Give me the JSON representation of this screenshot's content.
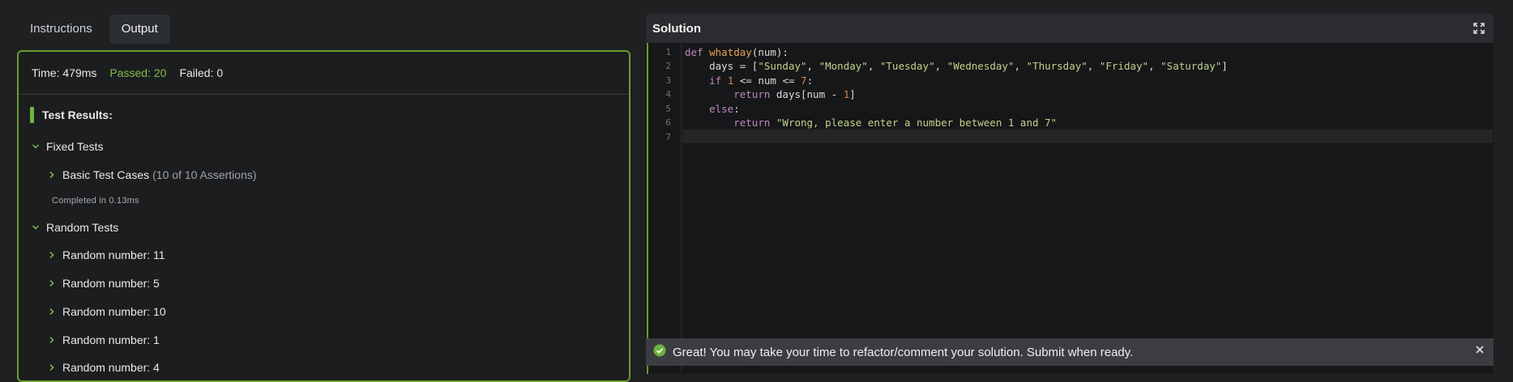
{
  "tabs": [
    {
      "label": "Instructions",
      "active": false
    },
    {
      "label": "Output",
      "active": true
    }
  ],
  "stats": {
    "time": "Time: 479ms",
    "passed": "Passed: 20",
    "failed": "Failed: 0"
  },
  "results_title": "Test Results:",
  "tree": {
    "fixed_group": "Fixed Tests",
    "basic_case": "Basic Test Cases",
    "basic_assertions": "(10 of 10 Assertions)",
    "completed": "Completed in 0.13ms",
    "random_group": "Random Tests",
    "random_items": [
      "Random number: 11",
      "Random number: 5",
      "Random number: 10",
      "Random number: 1",
      "Random number: 4"
    ]
  },
  "solution": {
    "title": "Solution",
    "line_numbers": [
      "1",
      "2",
      "3",
      "4",
      "5",
      "6",
      "7"
    ]
  },
  "toast": {
    "message": "Great! You may take your time to refactor/comment your solution. Submit when ready."
  },
  "colors": {
    "accent_green": "#6a9b2e",
    "passed_green": "#7fbf4a",
    "background": "#1e2022"
  }
}
